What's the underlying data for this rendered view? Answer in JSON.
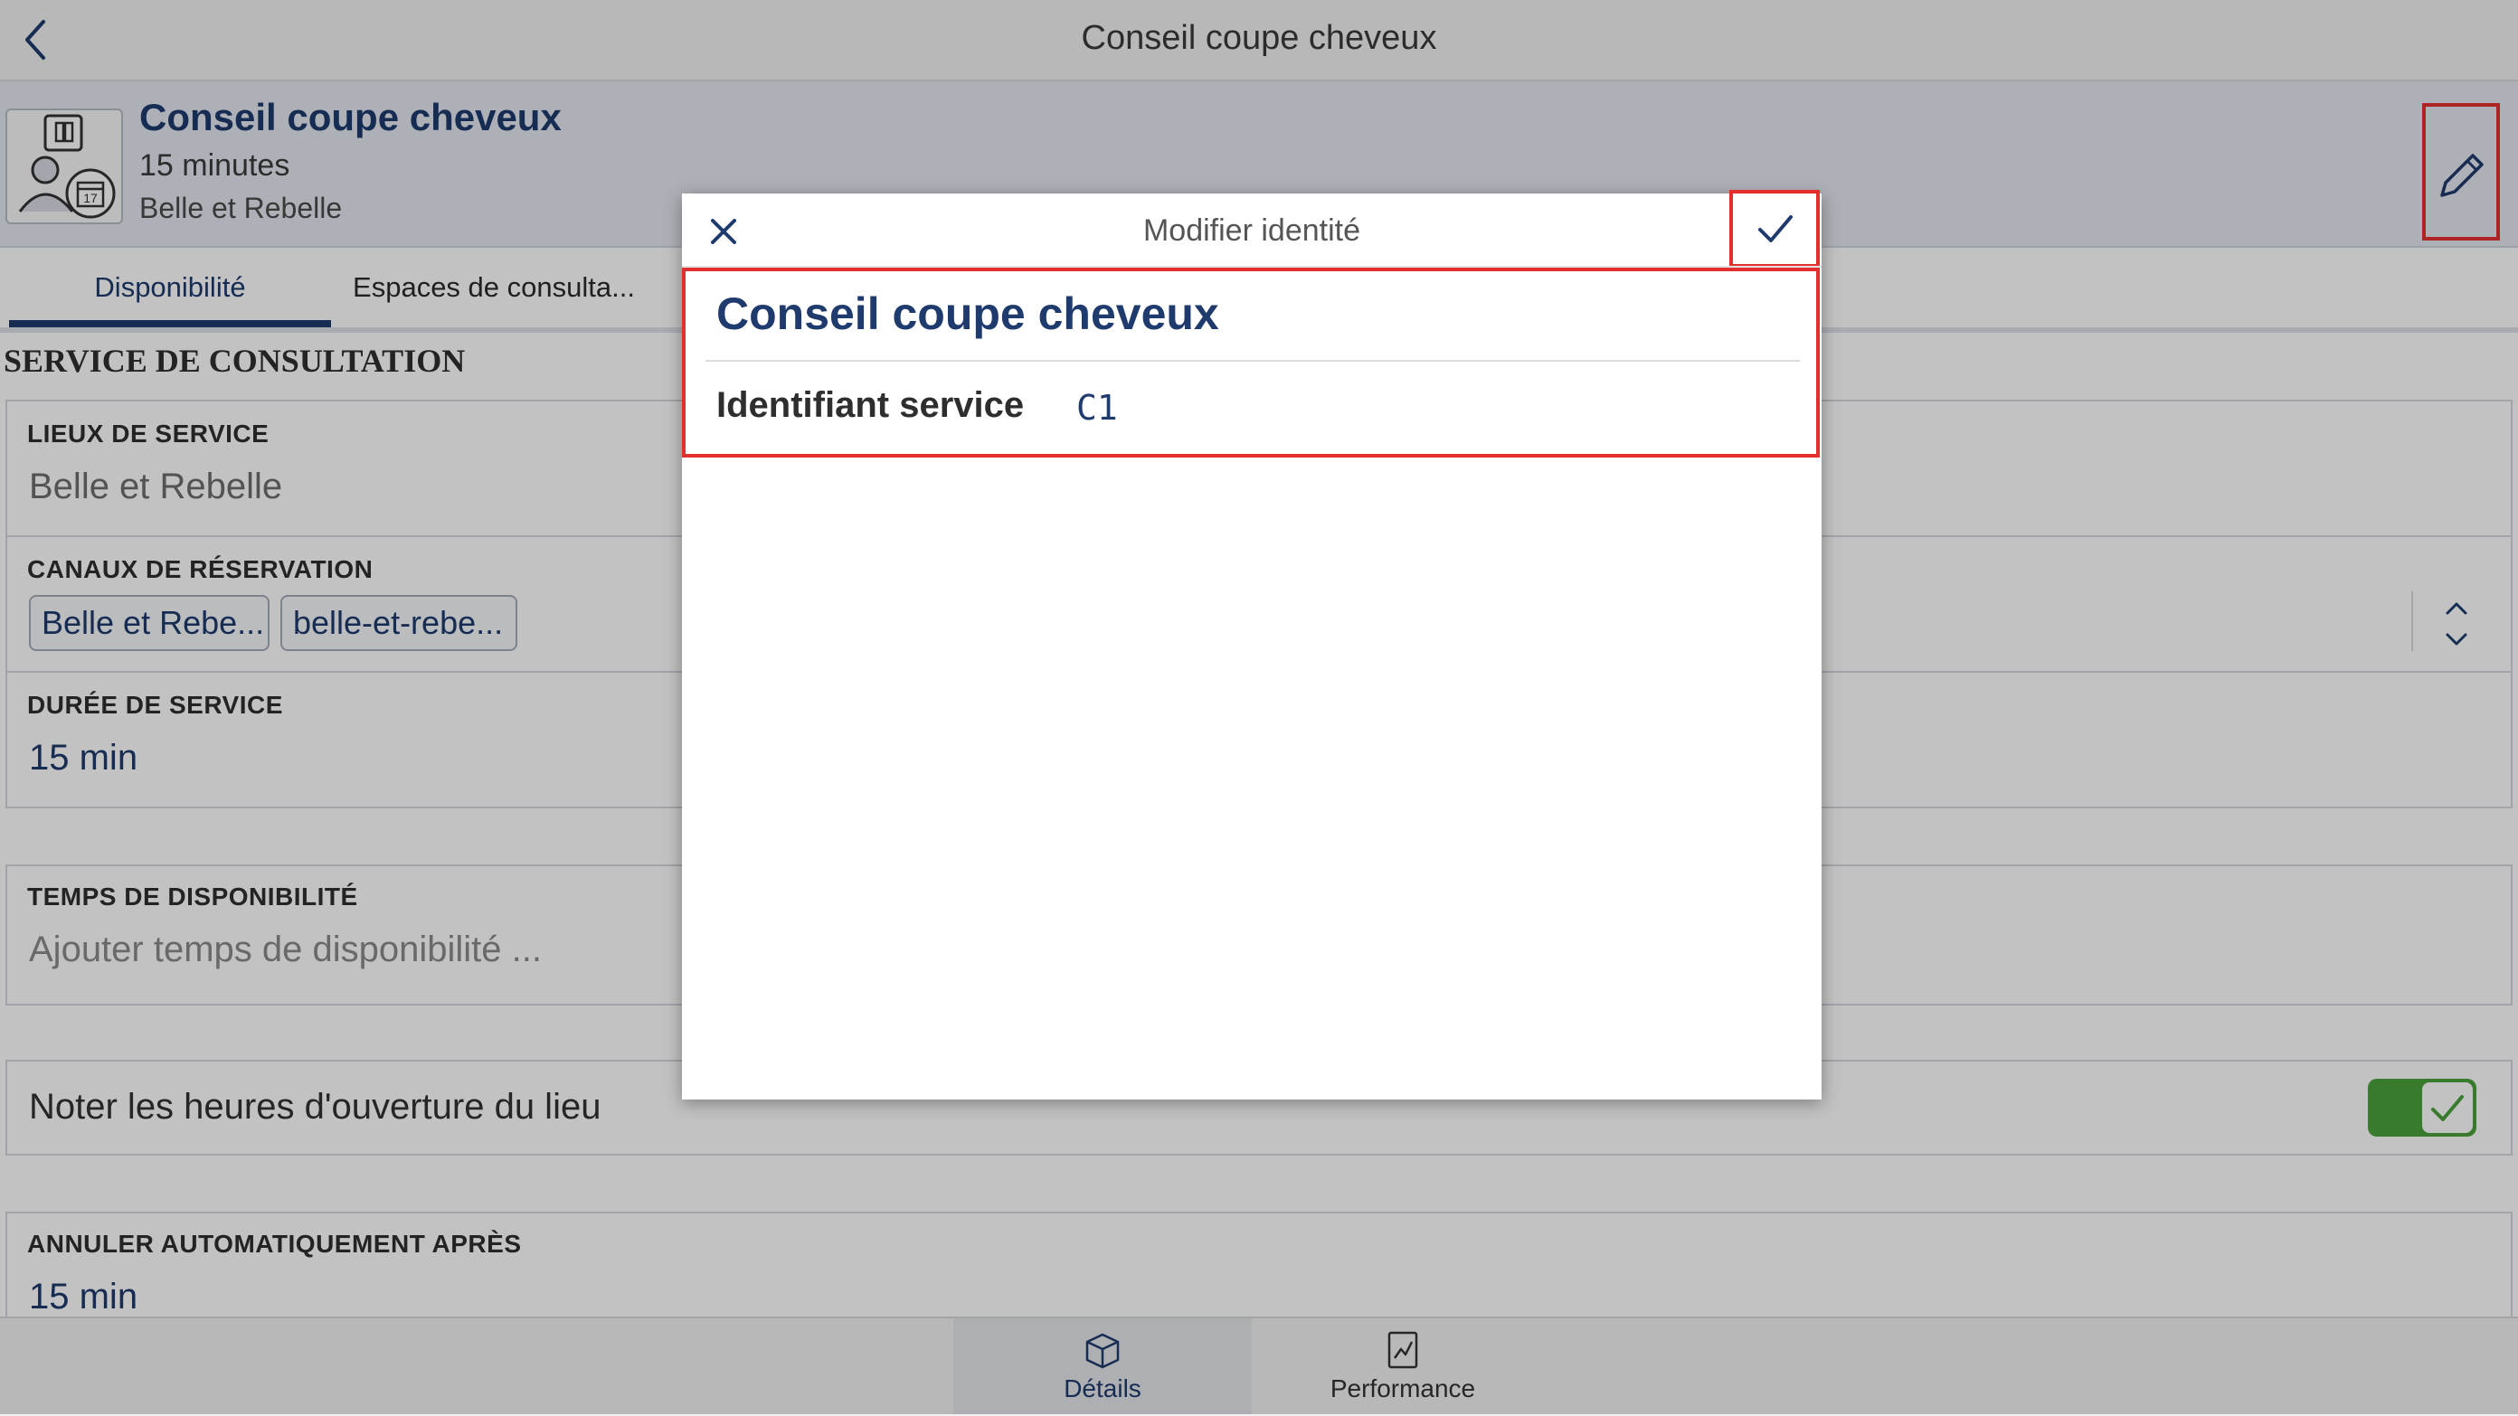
{
  "topbar": {
    "title": "Conseil coupe cheveux",
    "back_icon": "chevron-left-icon"
  },
  "header": {
    "title": "Conseil coupe cheveux",
    "duration": "15 minutes",
    "location": "Belle et Rebelle",
    "avatar_badge": "17",
    "edit_icon": "pencil-icon"
  },
  "tabs": [
    {
      "label": "Disponibilité",
      "active": true
    },
    {
      "label": "Espaces de consulta..."
    }
  ],
  "section": {
    "title": "SERVICE DE CONSULTATION"
  },
  "fields": {
    "lieux": {
      "label": "LIEUX DE SERVICE",
      "value": "Belle et Rebelle"
    },
    "canaux": {
      "label": "CANAUX DE RÉSERVATION",
      "chips": [
        "Belle et Rebe...",
        "belle-et-rebe..."
      ]
    },
    "duree": {
      "label": "DURÉE DE SERVICE",
      "value": "15 min"
    },
    "temps": {
      "label": "TEMPS DE DISPONIBILITÉ",
      "placeholder": "Ajouter temps de disponibilité ..."
    },
    "noter": {
      "label": "Noter les heures d'ouverture du lieu",
      "checked": true
    },
    "annuler": {
      "label": "ANNULER AUTOMATIQUEMENT APRÈS",
      "value": "15 min"
    }
  },
  "bottomnav": [
    {
      "label": "Détails",
      "icon": "package-icon",
      "active": true
    },
    {
      "label": "Performance",
      "icon": "report-icon"
    }
  ],
  "modal": {
    "title": "Modifier identité",
    "name": "Conseil coupe cheveux",
    "field_label": "Identifiant service",
    "field_value": "C1",
    "close_icon": "close-icon",
    "confirm_icon": "checkmark-icon"
  },
  "colors": {
    "primary": "#1f3b6e",
    "highlight": "#e52e2e",
    "toggle": "#4aa23b"
  }
}
